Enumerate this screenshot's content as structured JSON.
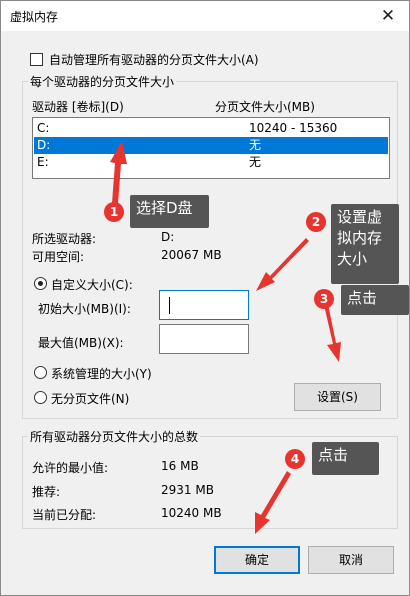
{
  "window": {
    "title": "虚拟内存",
    "close_glyph": "✕"
  },
  "auto_manage": {
    "label": "自动管理所有驱动器的分页文件大小(A)",
    "checked": false
  },
  "drives_group": {
    "label": "每个驱动器的分页文件大小",
    "col_drive": "驱动器 [卷标](D)",
    "col_size": "分页文件大小(MB)",
    "rows": [
      {
        "drive": "C:",
        "size": "10240 - 15360",
        "selected": false
      },
      {
        "drive": "D:",
        "size": "无",
        "selected": true
      },
      {
        "drive": "E:",
        "size": "无",
        "selected": false
      }
    ],
    "selected_drive_label": "所选驱动器:",
    "selected_drive_value": "D:",
    "free_space_label": "可用空间:",
    "free_space_value": "20067 MB",
    "custom_size_label": "自定义大小(C):",
    "initial_size_label": "初始大小(MB)(I):",
    "initial_size_value": "",
    "max_size_label": "最大值(MB)(X):",
    "max_size_value": "",
    "system_managed_label": "系统管理的大小(Y)",
    "no_paging_label": "无分页文件(N)",
    "set_button": "设置(S)"
  },
  "totals_group": {
    "label": "所有驱动器分页文件大小的总数",
    "min_label": "允许的最小值:",
    "min_value": "16 MB",
    "recommended_label": "推荐:",
    "recommended_value": "2931 MB",
    "current_label": "当前已分配:",
    "current_value": "10240 MB"
  },
  "buttons": {
    "ok": "确定",
    "cancel": "取消"
  },
  "annotations": [
    {
      "number": "1",
      "text": "选择D盘"
    },
    {
      "number": "2",
      "text": "设置虚\n拟内存\n大小"
    },
    {
      "number": "3",
      "text": "点击"
    },
    {
      "number": "4",
      "text": "点击"
    }
  ],
  "colors": {
    "selection": "#0078d7",
    "callout_bg": "#555555",
    "marker": "#e8342f"
  }
}
